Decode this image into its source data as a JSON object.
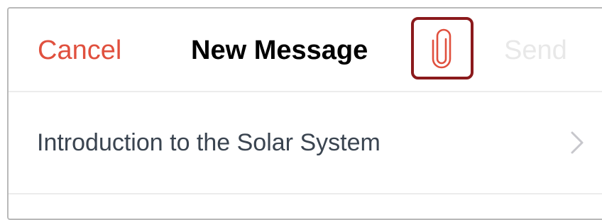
{
  "header": {
    "cancel_label": "Cancel",
    "title": "New Message",
    "send_label": "Send",
    "attach_icon": "paperclip-icon"
  },
  "course": {
    "label": "Introduction to the Solar System",
    "chevron_icon": "chevron-right-icon"
  },
  "colors": {
    "accent": "#e0503e",
    "highlight_border": "#8b1a1c",
    "disabled_text": "#e8e8e8",
    "body_text": "#3a4450"
  }
}
